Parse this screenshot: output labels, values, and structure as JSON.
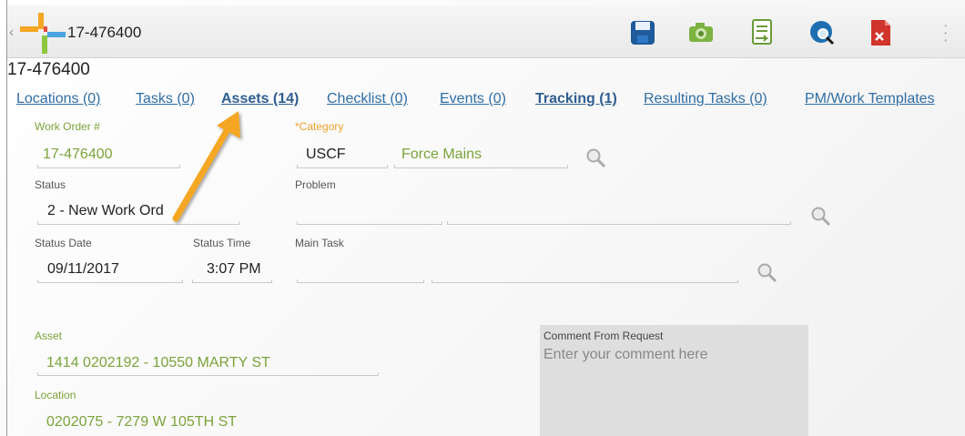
{
  "app": {
    "title": "17-476400",
    "toolbar": [
      {
        "name": "save-icon",
        "color": "#1e5a9c"
      },
      {
        "name": "camera-icon",
        "color": "#7cb342"
      },
      {
        "name": "document-icon",
        "color": "#6a9c3a"
      },
      {
        "name": "globe-search-icon",
        "color": "#1f6fb0"
      },
      {
        "name": "pdf-close-icon",
        "color": "#d0342c"
      },
      {
        "name": "overflow-menu-icon",
        "color": "#b5b5b5"
      }
    ]
  },
  "page_title": "17-476400",
  "tabs": [
    {
      "label": "Locations (0)",
      "bold": false
    },
    {
      "label": "Tasks (0)",
      "bold": false
    },
    {
      "label": "Assets (14)",
      "bold": true
    },
    {
      "label": "Checklist (0)",
      "bold": false
    },
    {
      "label": "Events (0)",
      "bold": false
    },
    {
      "label": "Tracking (1)",
      "bold": true
    },
    {
      "label": "Resulting Tasks (0)",
      "bold": false
    },
    {
      "label": "PM/Work Templates",
      "bold": false
    }
  ],
  "form": {
    "work_order": {
      "label": "Work Order #",
      "value": "17-476400"
    },
    "category": {
      "label": "*Category",
      "code": "USCF",
      "description": "Force Mains"
    },
    "status": {
      "label": "Status",
      "value": "2 - New Work Ord"
    },
    "problem": {
      "label": "Problem",
      "code": "",
      "description": ""
    },
    "status_date": {
      "label": "Status Date",
      "value": "09/11/2017"
    },
    "status_time": {
      "label": "Status Time",
      "value": "3:07 PM"
    },
    "main_task": {
      "label": "Main Task",
      "code": "",
      "description": ""
    },
    "asset": {
      "label": "Asset",
      "value": "1414 0202192 - 10550  MARTY ST"
    },
    "location": {
      "label": "Location",
      "value": "0202075 - 7279 W  105TH ST"
    },
    "comment": {
      "label": "Comment From Request",
      "placeholder": "Enter your comment here",
      "value": ""
    }
  },
  "colors": {
    "link": "#2f6ea6",
    "green_text": "#7aa33a",
    "required_label": "#f0a028",
    "annotation_arrow": "#f5a623"
  }
}
